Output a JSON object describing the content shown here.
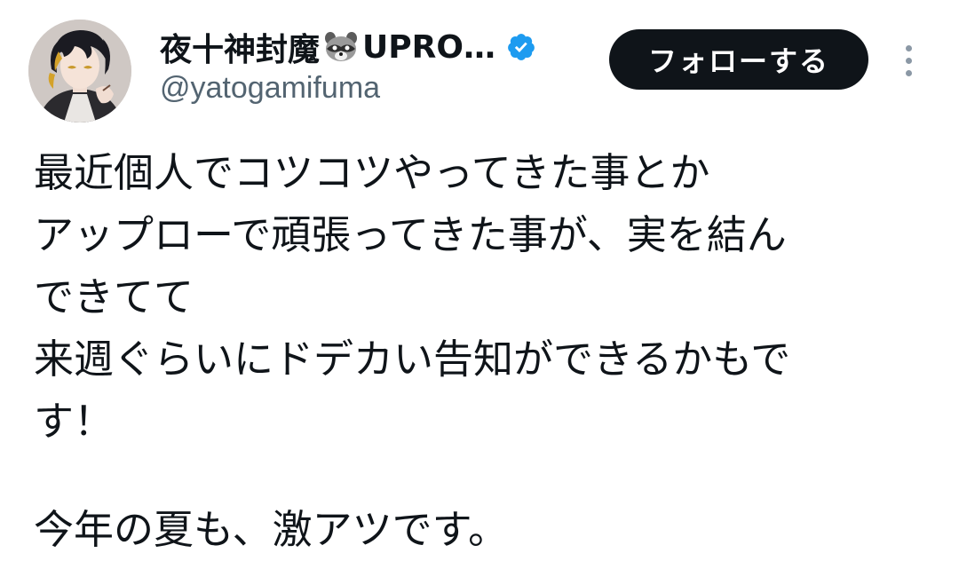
{
  "author": {
    "display_name": "夜十神封魔",
    "display_name_tail": "UPRO…",
    "handle": "@yatogamifuma",
    "verified": true,
    "emoji": "raccoon-icon"
  },
  "actions": {
    "follow_label": "フォローする",
    "more_icon": "more-vertical-icon"
  },
  "tweet": {
    "lines": [
      "最近個人でコツコツやってきた事とか",
      "アップローで頑張ってきた事が、実を結ん",
      "できてて",
      "来週ぐらいにドデカい告知ができるかもで",
      "す！"
    ],
    "closing_line": "今年の夏も、激アツです。"
  },
  "colors": {
    "text": "#0f1419",
    "secondary": "#536471",
    "verified": "#1d9bf0",
    "button_bg": "#0f1419",
    "button_text": "#ffffff"
  }
}
